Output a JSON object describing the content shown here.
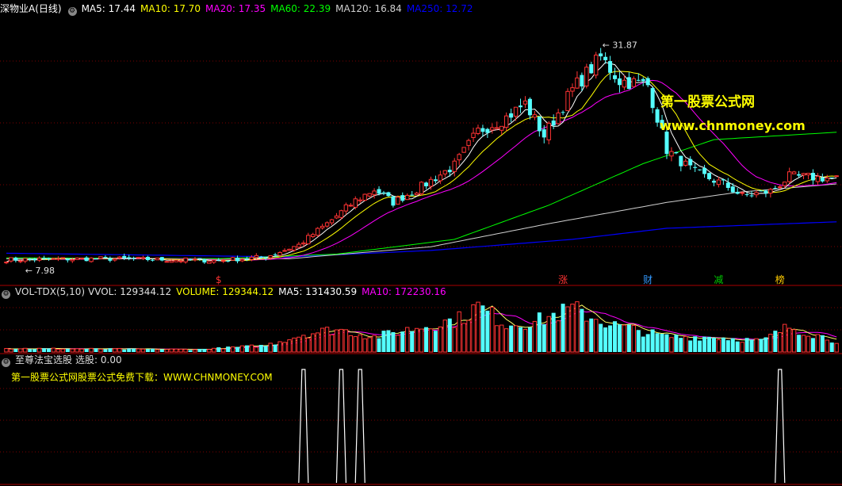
{
  "main_header": {
    "stock": "深物业A(日线)",
    "ma": [
      {
        "label": "MA5: 17.44",
        "color": "#ffffff"
      },
      {
        "label": "MA10: 17.70",
        "color": "#ffff00"
      },
      {
        "label": "MA20: 17.35",
        "color": "#ff00ff"
      },
      {
        "label": "MA60: 22.39",
        "color": "#00ff00"
      },
      {
        "label": "MA120: 16.84",
        "color": "#d0d0d0"
      },
      {
        "label": "MA250: 12.72",
        "color": "#0000ff"
      }
    ]
  },
  "vol_header": {
    "name": "VOL-TDX(5,10)",
    "items": [
      {
        "label": "VVOL: 129344.12",
        "color": "#e0e0e0"
      },
      {
        "label": "VOLUME: 129344.12",
        "color": "#ffff00"
      },
      {
        "label": "MA5: 131430.59",
        "color": "#ffffff"
      },
      {
        "label": "MA10: 172230.16",
        "color": "#ff00ff"
      }
    ]
  },
  "ind_header": {
    "name": "至尊法宝选股",
    "value": "选股: 0.00"
  },
  "indicator_note": "第一股票公式网股票公式免费下载：WWW.CHNMONEY.COM",
  "watermark": {
    "cn": "第一股票公式网",
    "url": "www.chnmoney.com"
  },
  "chart_data": {
    "type": "candlestick",
    "price_high_label": "31.87",
    "price_low_label": "7.98",
    "event_markers": [
      {
        "text": "$",
        "index": 45,
        "color": "#ff3333"
      },
      {
        "text": "涨",
        "index": 118,
        "color": "#ff3333"
      },
      {
        "text": "财",
        "index": 136,
        "color": "#3399ff"
      },
      {
        "text": "减",
        "index": 151,
        "color": "#00cc00"
      },
      {
        "text": "榜",
        "index": 164,
        "color": "#ffcc00"
      }
    ],
    "signals_at": [
      63,
      71,
      75,
      164
    ],
    "close_anchors": [
      [
        0,
        8.6
      ],
      [
        20,
        8.7
      ],
      [
        45,
        8.5
      ],
      [
        55,
        8.9
      ],
      [
        62,
        10.2
      ],
      [
        68,
        12.5
      ],
      [
        74,
        15.0
      ],
      [
        78,
        16.2
      ],
      [
        82,
        14.8
      ],
      [
        88,
        16.5
      ],
      [
        95,
        18.8
      ],
      [
        100,
        22.5
      ],
      [
        106,
        24.0
      ],
      [
        110,
        25.5
      ],
      [
        114,
        22.0
      ],
      [
        120,
        27.0
      ],
      [
        126,
        30.5
      ],
      [
        130,
        28.0
      ],
      [
        136,
        27.5
      ],
      [
        140,
        20.5
      ],
      [
        146,
        18.0
      ],
      [
        152,
        16.8
      ],
      [
        156,
        15.5
      ],
      [
        162,
        16.0
      ],
      [
        166,
        17.6
      ],
      [
        176,
        17.4
      ]
    ],
    "ma_anchors": {
      "ma60": [
        [
          0,
          8.8
        ],
        [
          45,
          8.7
        ],
        [
          70,
          9.2
        ],
        [
          95,
          10.8
        ],
        [
          115,
          14.5
        ],
        [
          135,
          19.0
        ],
        [
          150,
          21.6
        ],
        [
          176,
          22.4
        ]
      ],
      "ma120": [
        [
          0,
          8.7
        ],
        [
          60,
          8.7
        ],
        [
          90,
          10.0
        ],
        [
          115,
          12.5
        ],
        [
          140,
          14.8
        ],
        [
          155,
          15.9
        ],
        [
          176,
          16.8
        ]
      ],
      "ma250": [
        [
          0,
          9.3
        ],
        [
          60,
          8.9
        ],
        [
          90,
          9.6
        ],
        [
          120,
          10.8
        ],
        [
          140,
          12.0
        ],
        [
          176,
          12.7
        ]
      ]
    },
    "volume_anchors": [
      [
        0,
        0.07
      ],
      [
        40,
        0.05
      ],
      [
        55,
        0.13
      ],
      [
        63,
        0.35
      ],
      [
        70,
        0.45
      ],
      [
        78,
        0.3
      ],
      [
        88,
        0.5
      ],
      [
        96,
        0.65
      ],
      [
        100,
        0.9
      ],
      [
        106,
        0.55
      ],
      [
        112,
        0.6
      ],
      [
        120,
        0.85
      ],
      [
        128,
        0.55
      ],
      [
        140,
        0.3
      ],
      [
        150,
        0.3
      ],
      [
        160,
        0.22
      ],
      [
        166,
        0.5
      ],
      [
        176,
        0.22
      ]
    ],
    "ylim": [
      6.5,
      35
    ]
  }
}
